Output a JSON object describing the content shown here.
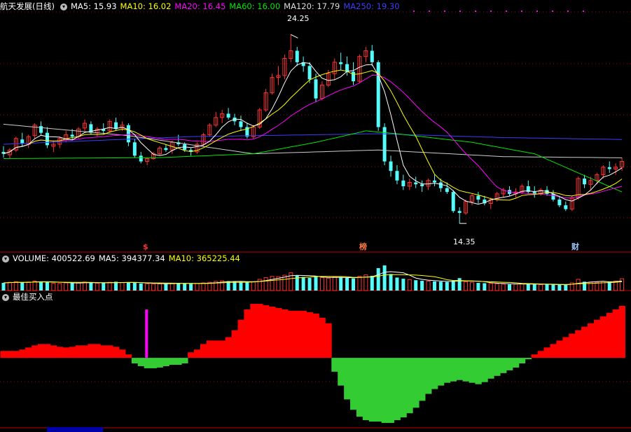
{
  "colors": {
    "up": "#ff3232",
    "down": "#54fcfc",
    "ma5": "#ffffff",
    "ma10": "#ffff00",
    "ma20": "#ff00ff",
    "ma60": "#00e600",
    "ma120": "#cccccc",
    "ma250": "#3c3cff",
    "bar_red": "#ff0000",
    "bar_green": "#33cc33",
    "signal": "#ff00ff",
    "grid_red": "#801010"
  },
  "header": {
    "title": "航天发展(日线)",
    "ma5": "MA5: 15.93",
    "ma10": "MA10: 16.02",
    "ma20": "MA20: 16.45",
    "ma60": "MA60: 16.00",
    "ma120": "MA120: 17.79",
    "ma250": "MA250: 19.30"
  },
  "volume_header": {
    "title": "VOLUME: 400522.69",
    "ma5": "MA5: 394377.34",
    "ma10": "MA10: 365225.44"
  },
  "indicator_header": {
    "title": "最佳买入点"
  },
  "marks": {
    "s": "$",
    "bang": "榜",
    "cai": "财"
  },
  "chart_data": [
    {
      "type": "candlestick",
      "title": "航天发展(日线)",
      "ylim": [
        13.4,
        25.4
      ],
      "annotations": [
        {
          "label": "24.25",
          "value": 24.25
        },
        {
          "label": "14.35",
          "value": 14.35
        }
      ],
      "ohlc": [
        [
          18.1,
          18.4,
          17.8,
          18.0
        ],
        [
          17.95,
          18.3,
          17.75,
          18.2
        ],
        [
          18.2,
          18.9,
          18.1,
          18.8
        ],
        [
          18.75,
          19.1,
          18.4,
          18.55
        ],
        [
          18.5,
          19.0,
          18.3,
          18.9
        ],
        [
          18.95,
          19.6,
          18.8,
          19.5
        ],
        [
          19.45,
          19.7,
          19.0,
          19.1
        ],
        [
          19.1,
          19.4,
          18.3,
          18.45
        ],
        [
          18.4,
          18.7,
          18.1,
          18.5
        ],
        [
          18.5,
          18.9,
          18.3,
          18.8
        ],
        [
          18.8,
          19.2,
          18.6,
          19.0
        ],
        [
          19.0,
          19.3,
          18.7,
          18.9
        ],
        [
          18.9,
          19.4,
          18.8,
          19.3
        ],
        [
          19.35,
          19.8,
          19.2,
          19.6
        ],
        [
          19.55,
          19.7,
          19.0,
          19.1
        ],
        [
          19.1,
          19.4,
          18.9,
          19.3
        ],
        [
          19.3,
          19.6,
          19.0,
          19.2
        ],
        [
          19.2,
          19.8,
          19.1,
          19.7
        ],
        [
          19.65,
          19.9,
          19.2,
          19.3
        ],
        [
          19.35,
          19.7,
          19.2,
          19.5
        ],
        [
          19.5,
          19.6,
          18.4,
          18.6
        ],
        [
          18.6,
          18.8,
          17.8,
          17.9
        ],
        [
          17.9,
          18.1,
          17.5,
          17.6
        ],
        [
          17.6,
          17.8,
          17.4,
          17.75
        ],
        [
          17.75,
          18.1,
          17.7,
          18.0
        ],
        [
          18.0,
          18.4,
          17.9,
          18.3
        ],
        [
          18.3,
          18.5,
          18.1,
          18.2
        ],
        [
          18.2,
          18.7,
          18.0,
          18.6
        ],
        [
          18.6,
          19.0,
          18.4,
          18.5
        ],
        [
          18.5,
          18.6,
          18.1,
          18.2
        ],
        [
          18.2,
          18.3,
          17.9,
          18.1
        ],
        [
          18.1,
          18.6,
          18.0,
          18.5
        ],
        [
          18.5,
          19.1,
          18.4,
          19.0
        ],
        [
          19.0,
          19.6,
          18.9,
          19.5
        ],
        [
          19.5,
          20.2,
          19.4,
          19.9
        ],
        [
          19.9,
          20.3,
          19.6,
          20.1
        ],
        [
          20.1,
          20.4,
          19.8,
          19.9
        ],
        [
          19.9,
          20.1,
          19.5,
          19.7
        ],
        [
          19.7,
          20.0,
          19.2,
          19.4
        ],
        [
          19.4,
          19.6,
          18.8,
          18.9
        ],
        [
          18.9,
          19.5,
          18.8,
          19.4
        ],
        [
          19.4,
          20.4,
          19.3,
          20.3
        ],
        [
          20.3,
          21.4,
          20.2,
          21.2
        ],
        [
          21.2,
          22.2,
          21.1,
          22.0
        ],
        [
          22.0,
          22.6,
          21.6,
          22.1
        ],
        [
          22.1,
          23.2,
          21.9,
          23.0
        ],
        [
          23.0,
          24.25,
          22.8,
          23.4
        ],
        [
          23.4,
          23.6,
          22.6,
          22.8
        ],
        [
          22.8,
          23.1,
          22.3,
          22.6
        ],
        [
          22.6,
          22.8,
          21.7,
          21.9
        ],
        [
          21.9,
          22.2,
          20.7,
          20.9
        ],
        [
          20.9,
          21.8,
          20.8,
          21.6
        ],
        [
          21.6,
          22.4,
          21.5,
          22.2
        ],
        [
          22.2,
          23.0,
          21.9,
          22.8
        ],
        [
          22.8,
          23.3,
          22.4,
          22.7
        ],
        [
          22.7,
          23.1,
          22.1,
          22.3
        ],
        [
          22.3,
          22.8,
          21.6,
          21.8
        ],
        [
          21.8,
          23.2,
          21.7,
          23.1
        ],
        [
          23.1,
          23.6,
          22.8,
          23.4
        ],
        [
          23.4,
          23.7,
          22.6,
          22.8
        ],
        [
          22.8,
          22.9,
          19.2,
          19.4
        ],
        [
          19.4,
          19.6,
          17.4,
          17.6
        ],
        [
          17.6,
          17.9,
          16.8,
          17.1
        ],
        [
          17.1,
          17.4,
          16.4,
          16.6
        ],
        [
          16.6,
          16.9,
          16.1,
          16.3
        ],
        [
          16.3,
          16.7,
          16.1,
          16.5
        ],
        [
          16.5,
          16.8,
          16.2,
          16.4
        ],
        [
          16.4,
          16.6,
          16.0,
          16.3
        ],
        [
          16.3,
          16.7,
          16.1,
          16.6
        ],
        [
          16.6,
          16.9,
          16.3,
          16.5
        ],
        [
          16.5,
          16.7,
          16.0,
          16.2
        ],
        [
          16.2,
          16.5,
          15.9,
          16.0
        ],
        [
          16.0,
          16.1,
          14.9,
          15.0
        ],
        [
          15.0,
          15.2,
          14.35,
          14.9
        ],
        [
          14.9,
          15.6,
          14.8,
          15.5
        ],
        [
          15.5,
          15.9,
          15.3,
          15.8
        ],
        [
          15.8,
          16.0,
          15.4,
          15.6
        ],
        [
          15.6,
          15.8,
          15.3,
          15.4
        ],
        [
          15.4,
          15.7,
          15.1,
          15.6
        ],
        [
          15.6,
          16.0,
          15.5,
          15.9
        ],
        [
          15.9,
          16.2,
          15.7,
          16.1
        ],
        [
          16.1,
          16.3,
          15.8,
          15.9
        ],
        [
          15.9,
          16.2,
          15.7,
          16.0
        ],
        [
          16.0,
          16.4,
          15.9,
          16.3
        ],
        [
          16.3,
          16.6,
          15.9,
          16.0
        ],
        [
          16.0,
          16.3,
          15.7,
          15.9
        ],
        [
          15.9,
          16.2,
          15.8,
          16.1
        ],
        [
          16.1,
          16.3,
          15.8,
          15.9
        ],
        [
          15.9,
          16.1,
          15.5,
          15.6
        ],
        [
          15.6,
          15.8,
          15.2,
          15.3
        ],
        [
          15.3,
          15.5,
          15.0,
          15.1
        ],
        [
          15.1,
          15.8,
          15.0,
          15.7
        ],
        [
          15.7,
          16.8,
          15.6,
          16.7
        ],
        [
          16.7,
          16.9,
          16.2,
          16.4
        ],
        [
          16.4,
          16.8,
          16.1,
          16.6
        ],
        [
          16.6,
          17.0,
          16.4,
          16.9
        ],
        [
          16.9,
          17.4,
          16.7,
          17.3
        ],
        [
          17.3,
          17.6,
          17.0,
          17.2
        ],
        [
          17.2,
          17.5,
          16.9,
          17.3
        ],
        [
          17.3,
          17.8,
          17.1,
          17.6
        ]
      ],
      "ma120_knots": [
        [
          0,
          19.55
        ],
        [
          20,
          18.95
        ],
        [
          40,
          18.0
        ],
        [
          60,
          18.2
        ],
        [
          80,
          17.85
        ],
        [
          99,
          17.79
        ]
      ],
      "ma250_knots": [
        [
          0,
          18.5
        ],
        [
          30,
          18.9
        ],
        [
          60,
          19.05
        ],
        [
          80,
          18.85
        ],
        [
          99,
          18.75
        ]
      ],
      "ma60_knots": [
        [
          0,
          17.75
        ],
        [
          25,
          17.8
        ],
        [
          40,
          18.0
        ],
        [
          50,
          18.6
        ],
        [
          58,
          19.2
        ],
        [
          63,
          19.05
        ],
        [
          75,
          18.6
        ],
        [
          85,
          18.0
        ],
        [
          99,
          16.0
        ]
      ]
    },
    {
      "type": "bar",
      "title": "VOLUME: 400522.69",
      "ylim": [
        0,
        900000
      ],
      "values": [
        260000,
        280000,
        300000,
        270000,
        290000,
        320000,
        310000,
        300000,
        250000,
        240000,
        260000,
        250000,
        270000,
        290000,
        270000,
        250000,
        260000,
        280000,
        300000,
        270000,
        280000,
        260000,
        240000,
        230000,
        220000,
        230000,
        240000,
        250000,
        260000,
        240000,
        230000,
        240000,
        260000,
        280000,
        310000,
        330000,
        320000,
        300000,
        290000,
        280000,
        300000,
        380000,
        440000,
        480000,
        470000,
        520000,
        600000,
        500000,
        460000,
        430000,
        470000,
        440000,
        420000,
        460000,
        450000,
        430000,
        410000,
        480000,
        530000,
        500000,
        760000,
        850000,
        560000,
        440000,
        400000,
        370000,
        350000,
        330000,
        320000,
        310000,
        300000,
        290000,
        330000,
        420000,
        300000,
        280000,
        260000,
        250000,
        240000,
        230000,
        220000,
        210000,
        220000,
        230000,
        220000,
        210000,
        200000,
        210000,
        200000,
        190000,
        200000,
        260000,
        380000,
        300000,
        290000,
        280000,
        310000,
        300000,
        320000,
        400523
      ]
    },
    {
      "type": "bar",
      "title": "最佳买入点",
      "ylim": [
        -100,
        80
      ],
      "values": [
        10,
        10,
        10,
        12,
        15,
        18,
        20,
        20,
        18,
        16,
        15,
        16,
        18,
        18,
        20,
        20,
        18,
        18,
        16,
        12,
        5,
        -8,
        -12,
        -15,
        -15,
        -14,
        -12,
        -10,
        -10,
        -8,
        8,
        12,
        20,
        25,
        25,
        25,
        30,
        40,
        55,
        70,
        78,
        78,
        76,
        74,
        72,
        70,
        68,
        68,
        68,
        66,
        64,
        58,
        50,
        -20,
        -40,
        -60,
        -75,
        -85,
        -90,
        -92,
        -92,
        -94,
        -94,
        -90,
        -86,
        -80,
        -72,
        -62,
        -52,
        -45,
        -40,
        -36,
        -34,
        -32,
        -34,
        -36,
        -38,
        -35,
        -30,
        -26,
        -22,
        -18,
        -14,
        -8,
        -2,
        5,
        10,
        15,
        20,
        25,
        30,
        35,
        40,
        45,
        50,
        55,
        60,
        65,
        70,
        75
      ],
      "signal_index": 22
    }
  ]
}
